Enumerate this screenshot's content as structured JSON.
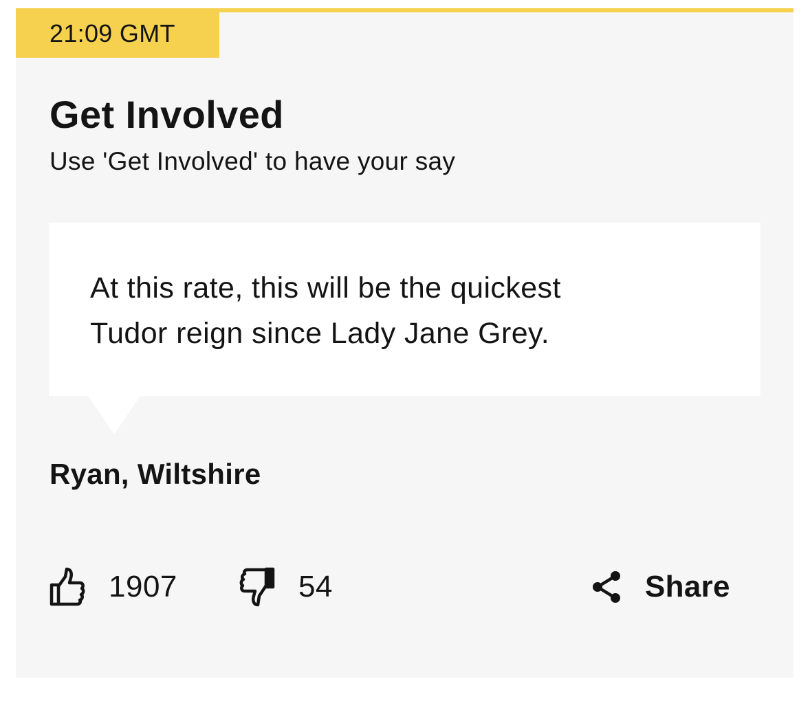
{
  "post": {
    "timestamp": "21:09 GMT",
    "title": "Get Involved",
    "subtitle": "Use 'Get Involved' to have your say",
    "quote_line1": "At this rate, this will be the quickest",
    "quote_line2": "Tudor reign since Lady Jane Grey.",
    "author": "Ryan, Wiltshire"
  },
  "actions": {
    "likes": "1907",
    "dislikes": "54",
    "share_label": "Share"
  },
  "icons": {
    "like": "thumbs-up-icon",
    "dislike": "thumbs-down-icon",
    "share": "share-icon"
  },
  "colors": {
    "accent": "#f5d14f",
    "card_background": "#f6f6f6",
    "quote_background": "#ffffff",
    "text": "#141414"
  }
}
